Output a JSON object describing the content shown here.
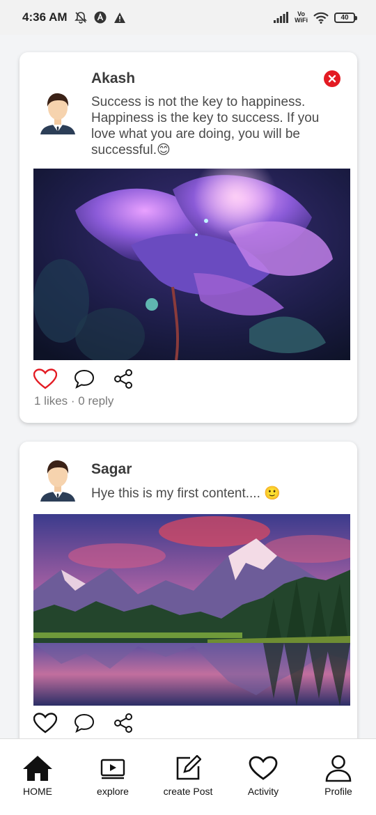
{
  "status_bar": {
    "time": "4:36 AM",
    "vowifi_top": "Vo",
    "vowifi_bottom": "WiFi",
    "battery": "40",
    "icons": [
      "mute-bell-icon",
      "a-circle-icon",
      "warning-icon",
      "signal-icon",
      "vowifi-icon",
      "wifi-icon",
      "battery-icon"
    ]
  },
  "feed": {
    "posts": [
      {
        "author": "Akash",
        "text": "Success is not the key to happiness. Happiness is the key to success. If you love what you are doing, you will be successful.😊",
        "image": "glowing-flower-image",
        "liked": true,
        "meta": "1 likes · 0 reply",
        "has_close": true
      },
      {
        "author": "Sagar",
        "text": "Hye this is my first content.... 🙂",
        "image": "mountain-lake-image",
        "liked": false,
        "has_close": false
      }
    ]
  },
  "colors": {
    "like_active": "#e31b23",
    "close": "#e31b23",
    "background": "#f3f4f6"
  },
  "bottom_nav": {
    "items": [
      {
        "label": "HOME",
        "icon": "home-icon"
      },
      {
        "label": "explore",
        "icon": "play-icon"
      },
      {
        "label": "create Post",
        "icon": "edit-icon"
      },
      {
        "label": "Activity",
        "icon": "heart-icon"
      },
      {
        "label": "Profile",
        "icon": "user-icon"
      }
    ]
  }
}
